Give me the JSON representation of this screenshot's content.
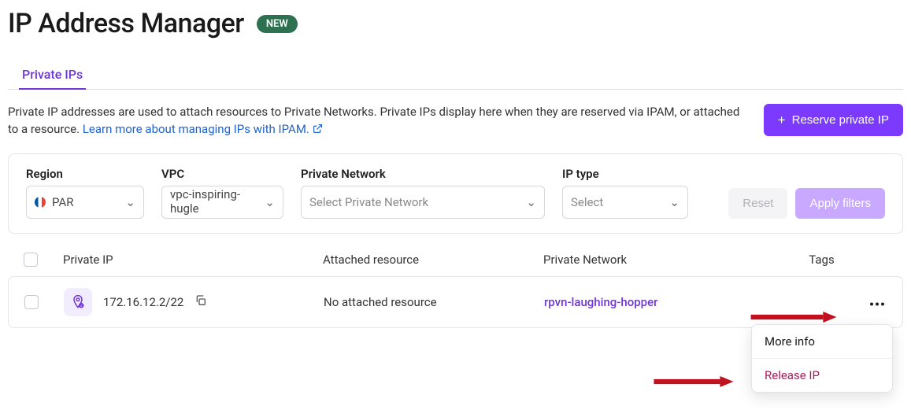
{
  "header": {
    "title": "IP Address Manager",
    "badge": "NEW"
  },
  "tabs": {
    "active": "Private IPs"
  },
  "description": {
    "text": "Private IP addresses are used to attach resources to Private Networks. Private IPs display here when they are reserved via IPAM, or attached to a resource. ",
    "link_text": "Learn more about managing IPs with IPAM."
  },
  "actions": {
    "reserve_label": "Reserve private IP"
  },
  "filters": {
    "region": {
      "label": "Region",
      "value": "PAR"
    },
    "vpc": {
      "label": "VPC",
      "value": "vpc-inspiring-hugle"
    },
    "private_network": {
      "label": "Private Network",
      "placeholder": "Select Private Network"
    },
    "ip_type": {
      "label": "IP type",
      "placeholder": "Select"
    },
    "reset_label": "Reset",
    "apply_label": "Apply filters"
  },
  "table": {
    "cols": {
      "c1": "Private IP",
      "c2": "Attached resource",
      "c3": "Private Network",
      "c4": "Tags"
    },
    "rows": [
      {
        "ip": "172.16.12.2/22",
        "attached": "No attached resource",
        "private_network": "rpvn-laughing-hopper"
      }
    ]
  },
  "menu": {
    "more_info": "More info",
    "release": "Release IP"
  }
}
